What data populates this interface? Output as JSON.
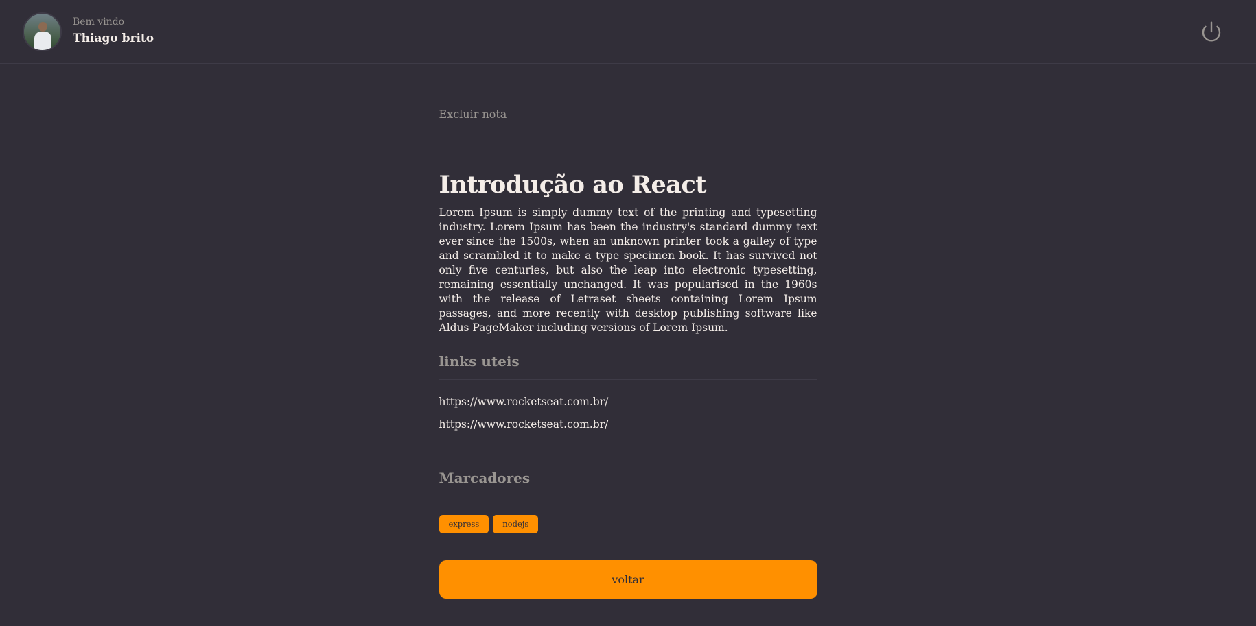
{
  "header": {
    "greeting": "Bem vindo",
    "user_name": "Thiago brito",
    "logout_icon": "power-icon"
  },
  "note": {
    "delete_label": "Excluir nota",
    "title": "Introdução ao React",
    "description": "Lorem Ipsum is simply dummy text of the printing and typesetting industry. Lorem Ipsum has been the industry's standard dummy text ever since the 1500s, when an unknown printer took a galley of type and scrambled it to make a type specimen book. It has survived not only five centuries, but also the leap into electronic typesetting, remaining essentially unchanged. It was popularised in the 1960s with the release of Letraset sheets containing Lorem Ipsum passages, and more recently with desktop publishing software like Aldus PageMaker including versions of Lorem Ipsum.",
    "links_title": "links uteis",
    "links": [
      "https://www.rocketseat.com.br/",
      "https://www.rocketseat.com.br/"
    ],
    "tags_title": "Marcadores",
    "tags": [
      "express",
      "nodejs"
    ],
    "back_label": "voltar"
  },
  "colors": {
    "background": "#312E38",
    "accent": "#FF9000",
    "text": "#F4EDE8",
    "muted": "#999591",
    "divider": "#3E3B47"
  }
}
